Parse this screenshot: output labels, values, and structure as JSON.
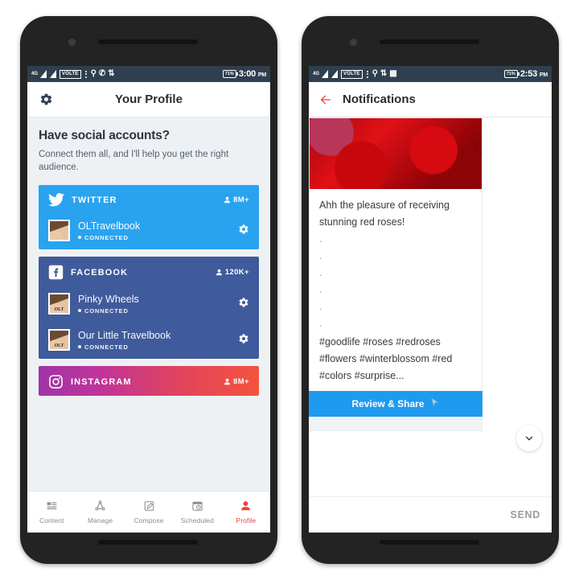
{
  "left_phone": {
    "status_bar": {
      "network": "4G",
      "volte": "VOLTE",
      "icons": [
        "kebab-menu-icon",
        "pin-icon",
        "whatsapp-icon",
        "bluetooth-icon"
      ],
      "battery": "71%",
      "time": "3:00",
      "meridiem": "PM"
    },
    "app_bar": {
      "gear_icon": "gear-icon",
      "title": "Your Profile"
    },
    "promo": {
      "heading": "Have social accounts?",
      "subtext": "Connect them all, and I'll help you get the right audience."
    },
    "cards": [
      {
        "brand": "TWITTER",
        "icon": "twitter-icon",
        "reach": "8M+",
        "color": "#29a3f0",
        "accounts": [
          {
            "name": "OLTravelbook",
            "status": "CONNECTED",
            "avatar": "account-avatar"
          }
        ]
      },
      {
        "brand": "FACEBOOK",
        "icon": "facebook-icon",
        "reach": "120K+",
        "color": "#3f5b9b",
        "accounts": [
          {
            "name": "Pinky Wheels",
            "status": "CONNECTED",
            "avatar": "account-avatar"
          },
          {
            "name": "Our Little Travelbook",
            "status": "CONNECTED",
            "avatar": "account-avatar"
          }
        ]
      },
      {
        "brand": "INSTAGRAM",
        "icon": "instagram-icon",
        "reach": "8M+",
        "color": "linear-gradient(90deg,#a033a8 0%,#c0349a 28%,#e0435f 62%,#f4533c 100%)",
        "accounts": []
      }
    ],
    "bottom_nav": [
      {
        "label": "Content",
        "icon": "content-list-icon",
        "active": false
      },
      {
        "label": "Manage",
        "icon": "network-nodes-icon",
        "active": false
      },
      {
        "label": "Compose",
        "icon": "compose-pencil-icon",
        "active": false
      },
      {
        "label": "Scheduled",
        "icon": "calendar-clock-icon",
        "active": false
      },
      {
        "label": "Profile",
        "icon": "person-icon",
        "active": true
      }
    ],
    "accent_color": "#e8453c"
  },
  "right_phone": {
    "status_bar": {
      "network": "4G",
      "volte": "VOLTE",
      "icons": [
        "kebab-menu-icon",
        "pin-icon",
        "bluetooth-icon",
        "image-icon"
      ],
      "battery": "71%",
      "time": "2:53",
      "meridiem": "PM"
    },
    "app_bar": {
      "back_icon": "back-arrow-icon",
      "title": "Notifications"
    },
    "notification": {
      "image": "red-roses-photo",
      "message": "Ahh the pleasure of receiving stunning red roses!",
      "spacer_dots": [
        ".",
        ".",
        ".",
        ".",
        ".",
        "."
      ],
      "hashtags": "#goodlife #roses #redroses #flowers #winterblossom #red #colors #surprise...",
      "action_label": "Review & Share",
      "action_icon": "cursor-pointer-icon",
      "action_color": "#1e9bf0"
    },
    "fab_icon": "chevron-down-icon",
    "send_label": "SEND"
  }
}
